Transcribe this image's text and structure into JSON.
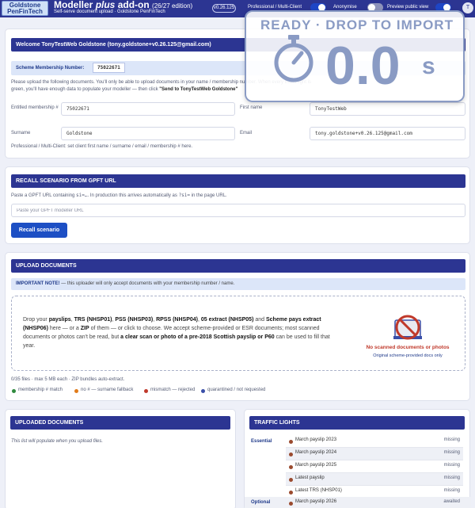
{
  "header": {
    "logo_line1": "Goldstone",
    "logo_line2": "PenFinTech",
    "title_main": "Modeller",
    "title_plus": "plus",
    "title_rest": "add-on",
    "edition": "(26/27 edition)",
    "subtitle": "Self-serve document upload · Goldstone PenFinTech",
    "version": "v0.26.125",
    "toggles": [
      {
        "label": "Professional / Multi-Client",
        "on": true
      },
      {
        "label": "Anonymise",
        "on": false
      },
      {
        "label": "Preview public view",
        "on": true
      }
    ],
    "user_initial": "T"
  },
  "welcome": {
    "title": "Welcome TonyTestWeb Goldstone (tony.goldstone+v0.26.125@gmail.com)",
    "membership_label": "Scheme Membership Number:",
    "membership_value": "75022671",
    "instructions_1": "Please upload the following documents. You'll only be able to upload documents in your name / membership number. When every traffic light is",
    "instructions_2_pre": "green, you'll have enough data to populate your modeller — then click ",
    "instructions_2_bold": "\"Send to TonyTestWeb Goldstone\"",
    "fields": {
      "membership_label": "Entitled membership #",
      "membership_value": "75022671",
      "firstname_label": "First name",
      "firstname_value": "TonyTestWeb",
      "surname_label": "Surname",
      "surname_value": "Goldstone",
      "email_label": "Email",
      "email_value": "tony.goldstone+v0.26.125@gmail.com"
    },
    "footnote": "Professional / Multi-Client: set client first name / surname / email / membership # here."
  },
  "recall": {
    "title": "RECALL SCENARIO FROM GPFT URL",
    "desc_pre": "Paste a GPFT URL containing ",
    "desc_code1": "si=…",
    "desc_mid": ". In production this arrives automatically as ",
    "desc_code2": "?si=",
    "desc_post": " in the page URL.",
    "placeholder": "Paste your GPFT modeller URL",
    "button": "Recall scenario"
  },
  "upload": {
    "title": "UPLOAD DOCUMENTS",
    "important_bold": "IMPORTANT NOTE!",
    "important_text": " — this uploader will only accept documents with your membership number / name.",
    "drop_text": {
      "t1": "Drop your ",
      "b1": "payslips",
      "t2": ", ",
      "b2": "TRS (NHSP01)",
      "t3": ", ",
      "b3": "PSS (NHSP03)",
      "t4": ", ",
      "b4": "RPSS (NHSP04)",
      "t5": ", ",
      "b5": "05 extract (NHSP05)",
      "t6": " and ",
      "b6": "Scheme pays extract (NHSP06)",
      "t7": " here — or a ",
      "b7": "ZIP",
      "t8": " of them — or click to choose. We accept scheme-provided or ESR documents; most scanned documents or photos can't be read, but ",
      "b8": "a clear scan or photo of a pre-2018 Scottish payslip or P60",
      "t9": " can be used to fill that year."
    },
    "no_scan_title": "No scanned documents or photos",
    "no_scan_sub": "Original scheme-provided docs only",
    "files_info": "0/35 files · max 5 MB each · ZIP bundles auto-extract.",
    "legend": [
      {
        "label": "membership # match",
        "color": "#2f8a3e"
      },
      {
        "label": "no # — surname fallback",
        "color": "#e07b1a"
      },
      {
        "label": "mismatch — rejected",
        "color": "#c0392b"
      },
      {
        "label": "quarantined / not requested",
        "color": "#3a4fa8"
      }
    ]
  },
  "uploaded": {
    "title": "UPLOADED DOCUMENTS",
    "empty_text": "This list will populate when you upload files."
  },
  "traffic": {
    "title": "TRAFFIC LIGHTS",
    "essential_label": "Essential",
    "optional_label": "Optional",
    "essential": [
      {
        "name": "March payslip 2023",
        "status": "missing"
      },
      {
        "name": "March payslip 2024",
        "status": "missing"
      },
      {
        "name": "March payslip 2025",
        "status": "missing"
      },
      {
        "name": "Latest payslip",
        "status": "missing"
      },
      {
        "name": "Latest TRS (NHSP01)",
        "status": "missing"
      }
    ],
    "optional": [
      {
        "name": "March payslip 2026",
        "status": "awaited"
      }
    ]
  },
  "timer": {
    "label": "READY · DROP TO IMPORT",
    "value": "0.0",
    "unit": "s"
  }
}
